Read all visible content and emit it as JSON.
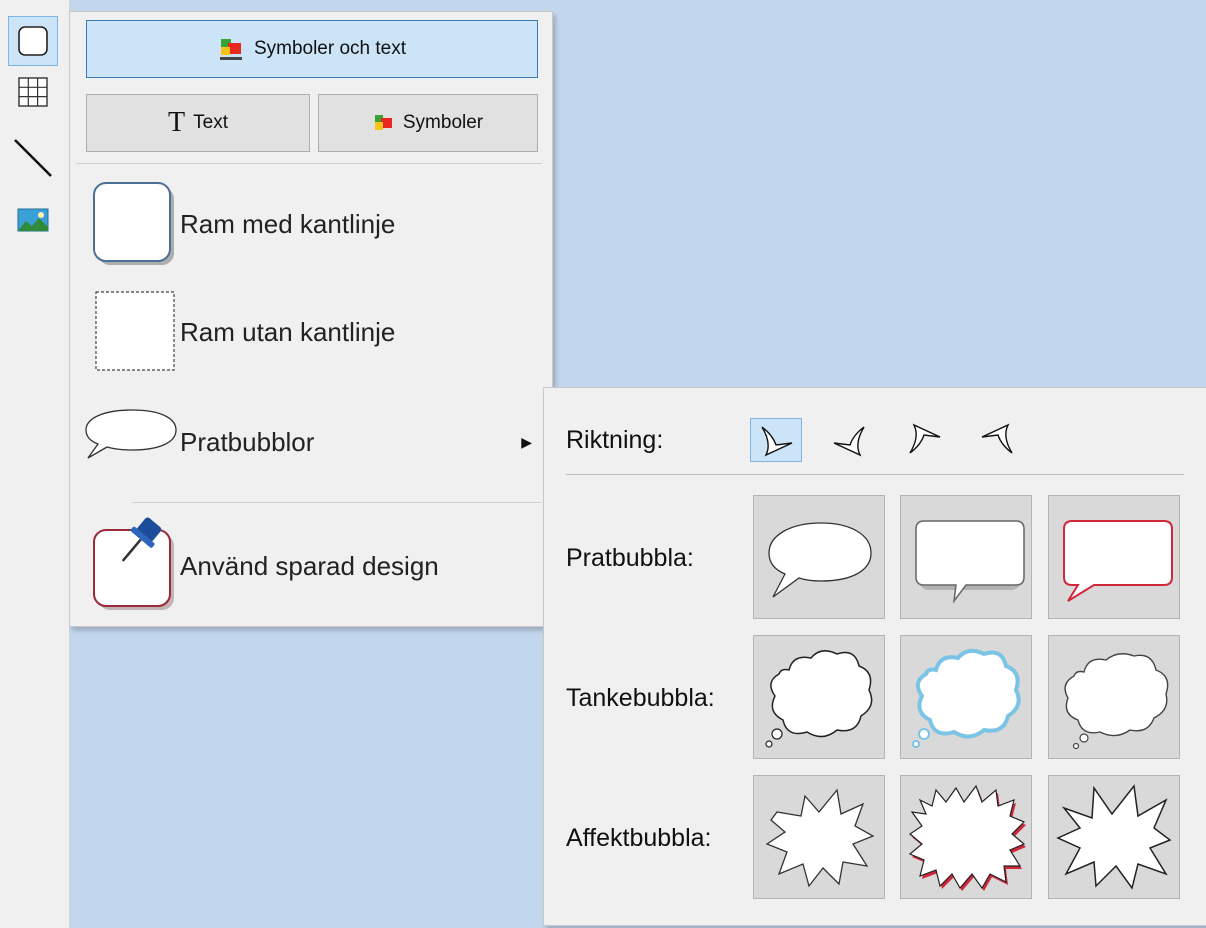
{
  "toolbar": {
    "tools": [
      {
        "icon": "frame-icon"
      },
      {
        "icon": "table-grid-icon"
      },
      {
        "icon": "line-icon"
      },
      {
        "icon": "picture-icon"
      }
    ]
  },
  "menu": {
    "symbols_and_text_label": "Symboler och text",
    "text_label": "Text",
    "symbols_label": "Symboler",
    "items": [
      {
        "label": "Ram med kantlinje"
      },
      {
        "label": "Ram utan kantlinje"
      },
      {
        "label": "Pratbubblor"
      },
      {
        "label": "Använd sparad design"
      }
    ]
  },
  "submenu": {
    "direction_label": "Riktning:",
    "rows": [
      {
        "label": "Pratbubbla:"
      },
      {
        "label": "Tankebubbla:"
      },
      {
        "label": "Affektbubbla:"
      }
    ]
  },
  "colors": {
    "accent": "#cce4f7",
    "accent_border": "#3d7bb6",
    "canvas": "#c2d6ee",
    "red_outline": "#d0283a",
    "blue_outline": "#7cc4e6"
  }
}
